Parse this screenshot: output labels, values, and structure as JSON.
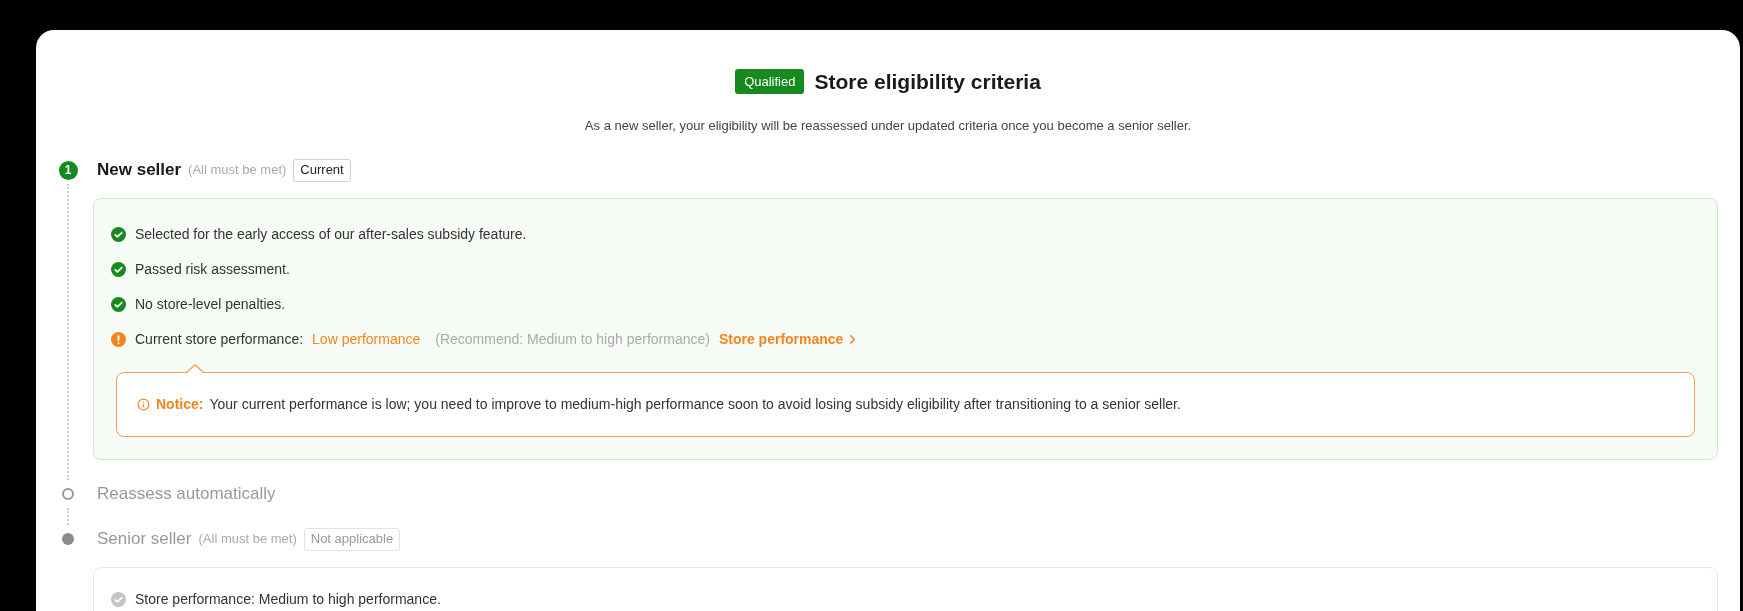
{
  "header": {
    "badge": "Qualified",
    "title": "Store eligibility criteria",
    "subtitle": "As a new seller, your eligibility will be reassessed under updated criteria once you become a senior seller."
  },
  "steps": [
    {
      "kind": "numbered",
      "marker": "1",
      "title": "New seller",
      "note": "(All must be met)",
      "tag": "Current",
      "active": true,
      "criteria": [
        {
          "kind": "met",
          "text": "Selected for the early access of our after-sales subsidy feature."
        },
        {
          "kind": "met",
          "text": "Passed risk assessment."
        },
        {
          "kind": "met",
          "text": "No store-level penalties."
        },
        {
          "kind": "warning",
          "text": "Current store performance:",
          "value": "Low performance",
          "hint": "(Recommend: Medium to high performance)",
          "link": "Store performance"
        }
      ],
      "notice": {
        "label": "Notice:",
        "text": "Your current performance is low; you need to improve to medium-high performance soon to avoid losing subsidy eligibility after transitioning to a senior seller."
      }
    },
    {
      "kind": "hollow",
      "title": "Reassess automatically",
      "active": false
    },
    {
      "kind": "dot",
      "title": "Senior seller",
      "note": "(All must be met)",
      "tag": "Not applicable",
      "active": false,
      "criteria": [
        {
          "kind": "pending",
          "text": "Store performance: Medium to high performance."
        }
      ]
    }
  ]
}
